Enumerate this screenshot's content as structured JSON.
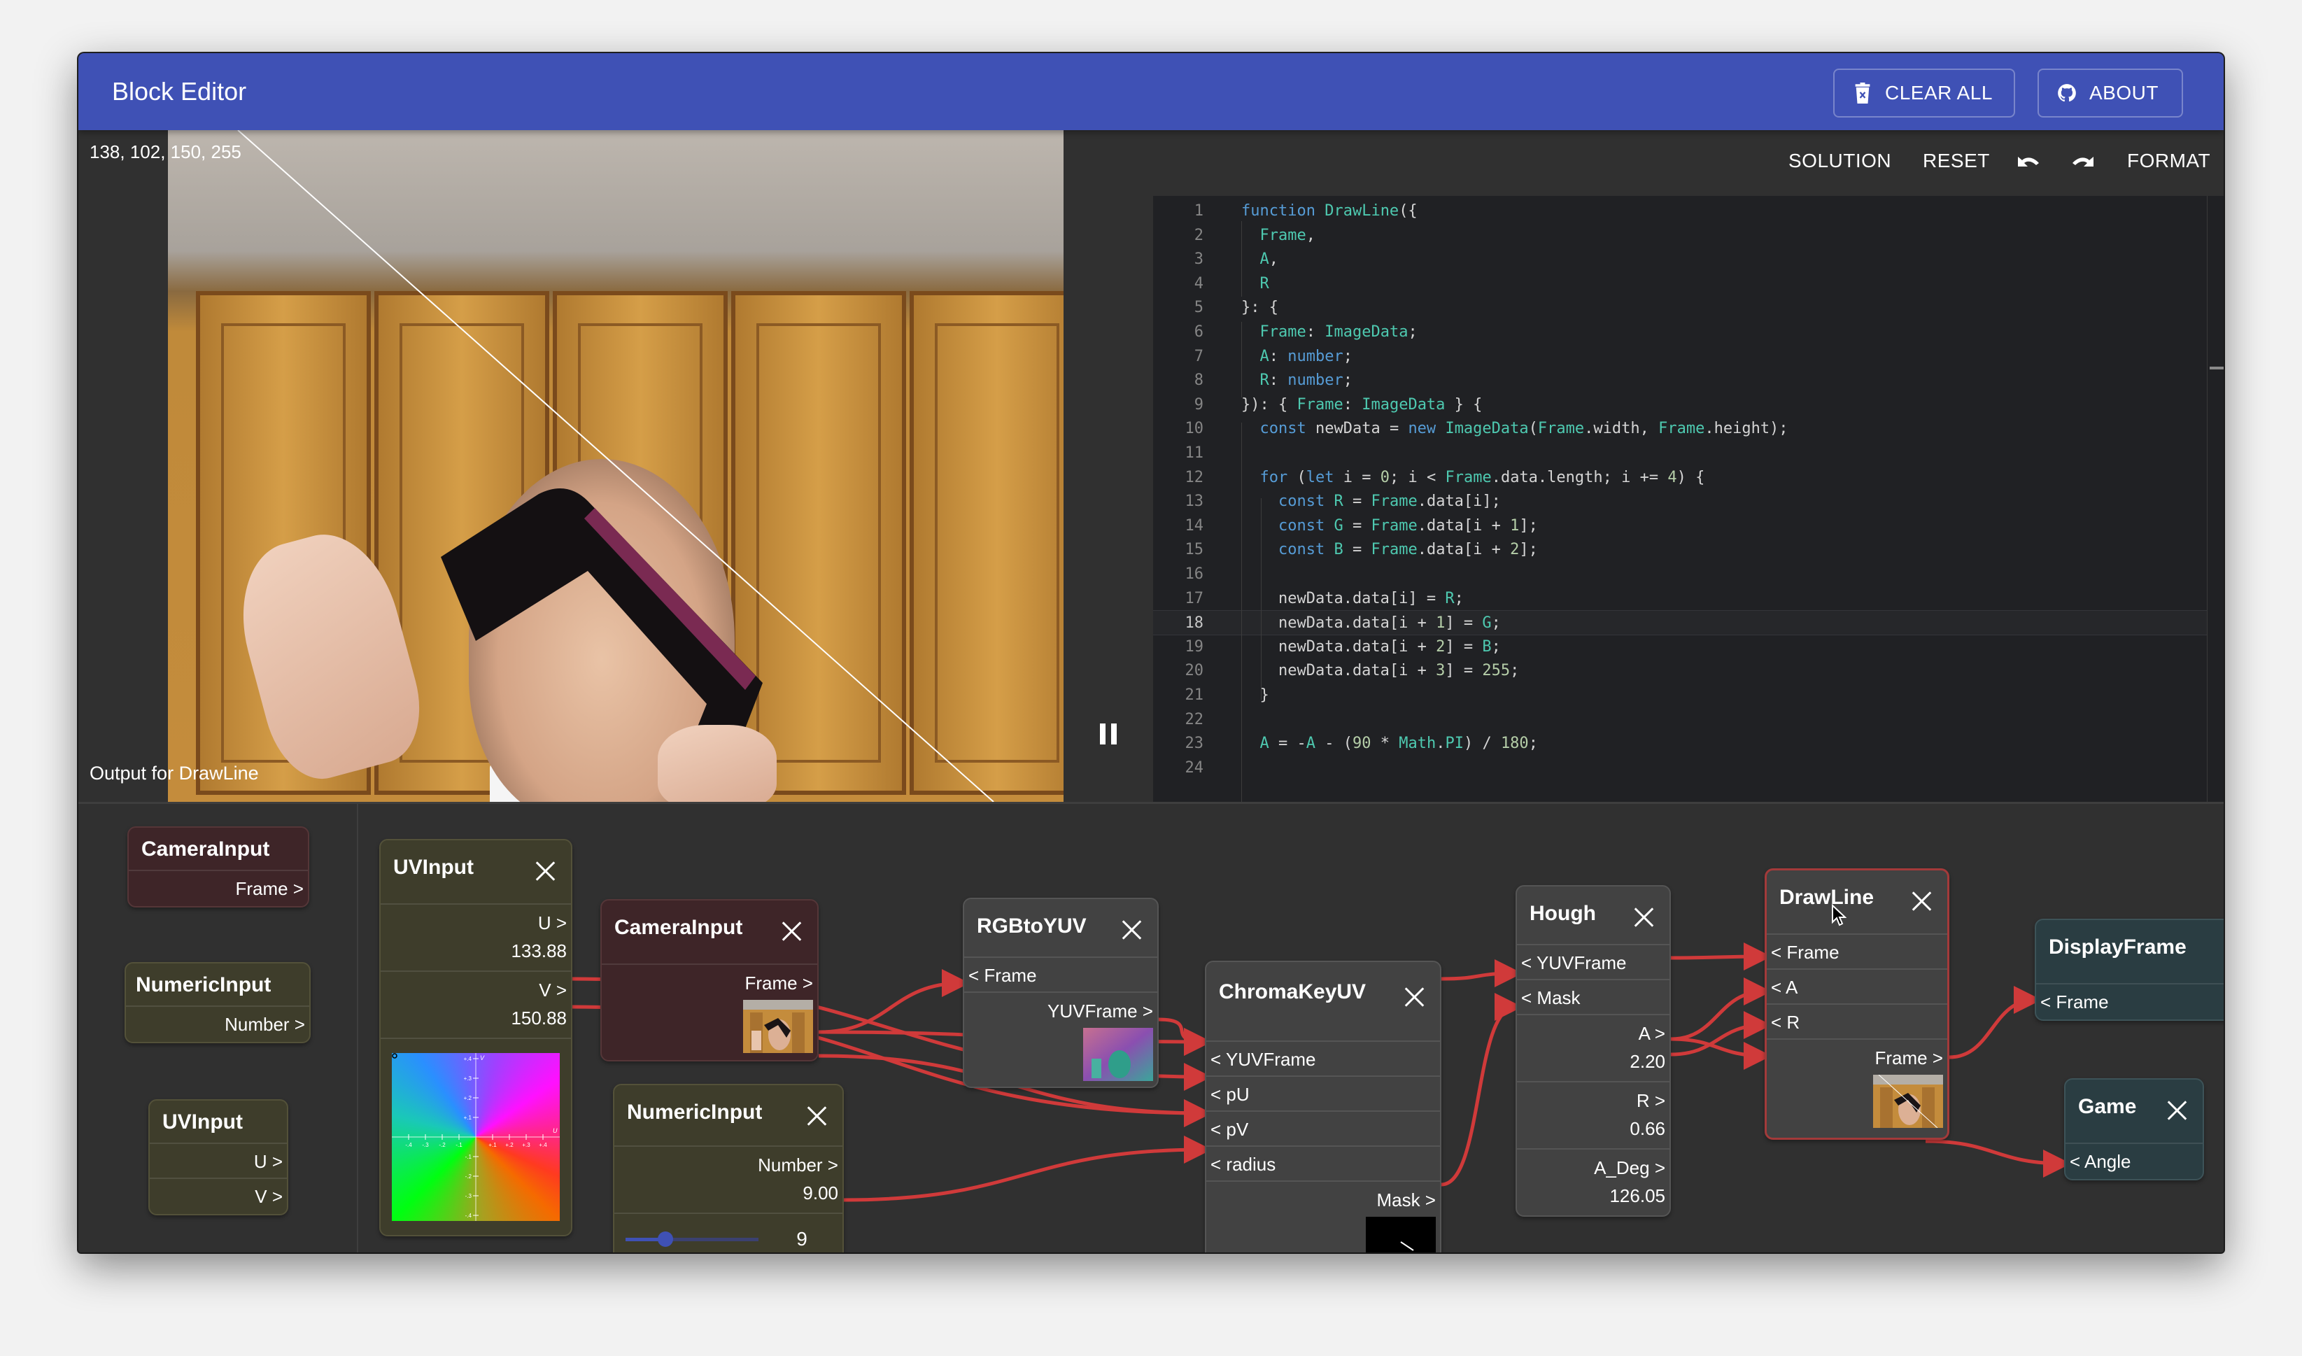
{
  "appbar": {
    "title": "Block Editor",
    "clear_all_label": "CLEAR ALL",
    "about_label": "ABOUT",
    "accent_color": "#3f51b5"
  },
  "preview": {
    "pixel_readout": "138, 102, 150, 255",
    "output_label": "Output for DrawLine",
    "playback_icon": "pause-icon"
  },
  "editor_toolbar": {
    "solution_label": "SOLUTION",
    "reset_label": "RESET",
    "undo_icon": "undo-icon",
    "redo_icon": "redo-icon",
    "format_label": "FORMAT",
    "run_icon": "play-icon"
  },
  "code": {
    "active_line": 18,
    "lines": [
      {
        "n": "1",
        "t": "function DrawLine({"
      },
      {
        "n": "2",
        "t": "  Frame,"
      },
      {
        "n": "3",
        "t": "  A,"
      },
      {
        "n": "4",
        "t": "  R"
      },
      {
        "n": "5",
        "t": "}: {"
      },
      {
        "n": "6",
        "t": "  Frame: ImageData;"
      },
      {
        "n": "7",
        "t": "  A: number;"
      },
      {
        "n": "8",
        "t": "  R: number;"
      },
      {
        "n": "9",
        "t": "}): { Frame: ImageData } {"
      },
      {
        "n": "10",
        "t": "  const newData = new ImageData(Frame.width, Frame.height);"
      },
      {
        "n": "11",
        "t": ""
      },
      {
        "n": "12",
        "t": "  for (let i = 0; i < Frame.data.length; i += 4) {"
      },
      {
        "n": "13",
        "t": "    const R = Frame.data[i];"
      },
      {
        "n": "14",
        "t": "    const G = Frame.data[i + 1];"
      },
      {
        "n": "15",
        "t": "    const B = Frame.data[i + 2];"
      },
      {
        "n": "16",
        "t": ""
      },
      {
        "n": "17",
        "t": "    newData.data[i] = R;"
      },
      {
        "n": "18",
        "t": "    newData.data[i + 1] = G;"
      },
      {
        "n": "19",
        "t": "    newData.data[i + 2] = B;"
      },
      {
        "n": "20",
        "t": "    newData.data[i + 3] = 255;"
      },
      {
        "n": "21",
        "t": "  }"
      },
      {
        "n": "22",
        "t": ""
      },
      {
        "n": "23",
        "t": "  A = -A - (90 * Math.PI) / 180;"
      },
      {
        "n": "24",
        "t": ""
      }
    ]
  },
  "palette": {
    "blocks": [
      {
        "title": "CameraInput",
        "outputs": [
          "Frame >"
        ]
      },
      {
        "title": "NumericInput",
        "outputs": [
          "Number >"
        ]
      },
      {
        "title": "UVInput",
        "outputs": [
          "U >",
          "V >"
        ]
      }
    ]
  },
  "nodes": {
    "uvinput": {
      "title": "UVInput",
      "u_label": "U >",
      "u_value": "133.88",
      "v_label": "V >",
      "v_value": "150.88",
      "plane_axis_u": "U",
      "plane_axis_v": "V",
      "ticks_u": [
        "-.4",
        "-.3",
        "-.2",
        "-.1",
        "+.1",
        "+.2",
        "+.3",
        "+.4"
      ],
      "ticks_v": [
        "+.4",
        "+.3",
        "+.2",
        "+.1",
        "-.1",
        "-.2",
        "-.3",
        "-.4"
      ]
    },
    "camerainput": {
      "title": "CameraInput",
      "frame_label": "Frame >"
    },
    "numericinput": {
      "title": "NumericInput",
      "number_label": "Number >",
      "number_value": "9.00",
      "field_value": "9",
      "slider_fraction": 0.3
    },
    "rgbtoyuv": {
      "title": "RGBtoYUV",
      "in_frame": "< Frame",
      "out_yuv": "YUVFrame >"
    },
    "chromakeyuv": {
      "title": "ChromaKeyUV",
      "in_yuv": "< YUVFrame",
      "in_pu": "< pU",
      "in_pv": "< pV",
      "in_radius": "< radius",
      "out_mask": "Mask >"
    },
    "hough": {
      "title": "Hough",
      "in_yuv": "< YUVFrame",
      "in_mask": "< Mask",
      "a_label": "A >",
      "a_value": "2.20",
      "r_label": "R >",
      "r_value": "0.66",
      "adeg_label": "A_Deg >",
      "adeg_value": "126.05"
    },
    "drawline": {
      "title": "DrawLine",
      "in_frame": "< Frame",
      "in_a": "< A",
      "in_r": "< R",
      "out_frame": "Frame >"
    },
    "displayframe": {
      "title": "DisplayFrame",
      "in_frame": "< Frame"
    },
    "game": {
      "title": "Game",
      "in_angle": "< Angle"
    }
  },
  "wire_color": "#d03a3a"
}
